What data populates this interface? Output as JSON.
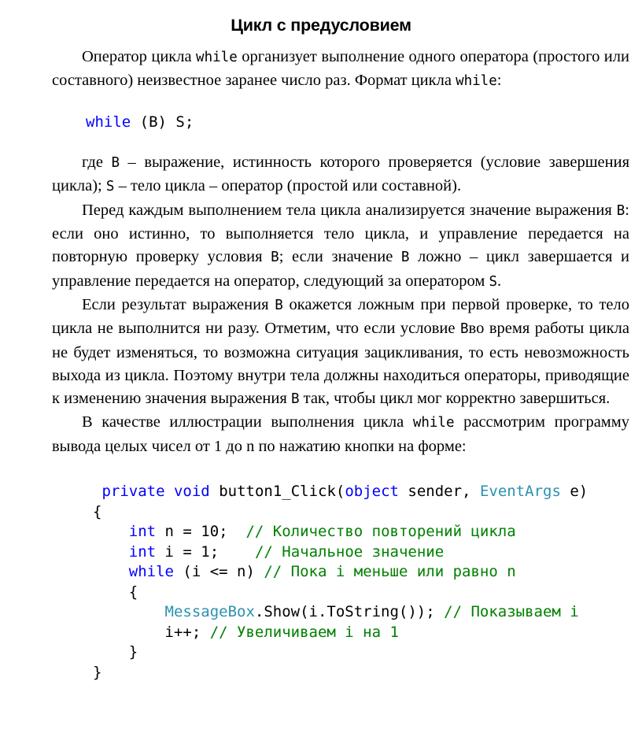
{
  "document": {
    "title": "Цикл с предусловием",
    "paragraphs": [
      {
        "id": "p1",
        "runs": [
          {
            "t": "Оператор цикла ",
            "s": "text"
          },
          {
            "t": "while",
            "s": "mono"
          },
          {
            "t": "  организует выполнение одного оператора (простого или составного) неизвестное заранее число раз. Формат цикла ",
            "s": "text"
          },
          {
            "t": "while",
            "s": "mono"
          },
          {
            "t": ":",
            "s": "text"
          }
        ]
      },
      {
        "id": "p2",
        "runs": [
          {
            "t": "где ",
            "s": "text"
          },
          {
            "t": "B",
            "s": "mono"
          },
          {
            "t": "  – выражение, истинность которого проверяется (условие завершения цикла); ",
            "s": "text"
          },
          {
            "t": "S",
            "s": "mono"
          },
          {
            "t": " – тело цикла – оператор (простой или составной).",
            "s": "text"
          }
        ]
      },
      {
        "id": "p3",
        "runs": [
          {
            "t": "Перед каждым выполнением тела цикла анализируется значение выражения ",
            "s": "text"
          },
          {
            "t": "B",
            "s": "mono"
          },
          {
            "t": ": если оно истинно, то выполняется тело цикла, и управление передается на повторную проверку условия ",
            "s": "text"
          },
          {
            "t": "B",
            "s": "mono"
          },
          {
            "t": "; если значение ",
            "s": "text"
          },
          {
            "t": "B",
            "s": "mono"
          },
          {
            "t": "  ложно – цикл завершается и управление передается на оператор, следующий за оператором ",
            "s": "text"
          },
          {
            "t": "S",
            "s": "mono"
          },
          {
            "t": ".",
            "s": "text"
          }
        ]
      },
      {
        "id": "p4",
        "runs": [
          {
            "t": "Если результат выражения ",
            "s": "text"
          },
          {
            "t": "B",
            "s": "mono"
          },
          {
            "t": "  окажется ложным при первой проверке, то тело цикла не выполнится ни разу. Отметим, что если условие  ",
            "s": "text"
          },
          {
            "t": "B",
            "s": "mono"
          },
          {
            "t": "во время работы цикла не будет изменяться, то возможна ситуация зацикливания, то есть невозможность выхода из цикла. Поэтому внутри тела должны находиться операторы, приводящие к изменению значения выражения ",
            "s": "text"
          },
          {
            "t": "B",
            "s": "mono"
          },
          {
            "t": " так, чтобы цикл мог корректно завершиться.",
            "s": "text"
          }
        ]
      },
      {
        "id": "p5",
        "runs": [
          {
            "t": "В качестве иллюстрации выполнения цикла ",
            "s": "text"
          },
          {
            "t": "while",
            "s": "mono"
          },
          {
            "t": "  рассмотрим программу вывода целых чисел от 1 до n по нажатию кнопки на форме:",
            "s": "text"
          }
        ]
      }
    ],
    "syntax_line": {
      "tokens": [
        {
          "t": "while",
          "c": "kw"
        },
        {
          "t": " (B) S;",
          "c": "pln"
        }
      ]
    },
    "code_listing": {
      "language": "csharp",
      "lines": [
        [
          {
            "t": " ",
            "c": "pln"
          },
          {
            "t": "private",
            "c": "kw"
          },
          {
            "t": " ",
            "c": "pln"
          },
          {
            "t": "void",
            "c": "kw"
          },
          {
            "t": " button1_Click(",
            "c": "pln"
          },
          {
            "t": "object",
            "c": "kw"
          },
          {
            "t": " sender, ",
            "c": "pln"
          },
          {
            "t": "EventArgs",
            "c": "type"
          },
          {
            "t": " e)",
            "c": "pln"
          }
        ],
        [
          {
            "t": "{",
            "c": "pln"
          }
        ],
        [
          {
            "t": "    ",
            "c": "pln"
          },
          {
            "t": "int",
            "c": "kw"
          },
          {
            "t": " n = 10;  ",
            "c": "pln"
          },
          {
            "t": "// Количество повторений цикла",
            "c": "cmt"
          }
        ],
        [
          {
            "t": "    ",
            "c": "pln"
          },
          {
            "t": "int",
            "c": "kw"
          },
          {
            "t": " i = 1;    ",
            "c": "pln"
          },
          {
            "t": "// Начальное значение",
            "c": "cmt"
          }
        ],
        [
          {
            "t": "    ",
            "c": "pln"
          },
          {
            "t": "while",
            "c": "kw"
          },
          {
            "t": " (i <= n) ",
            "c": "pln"
          },
          {
            "t": "// Пока i меньше или равно n",
            "c": "cmt"
          }
        ],
        [
          {
            "t": "    {",
            "c": "pln"
          }
        ],
        [
          {
            "t": "        ",
            "c": "pln"
          },
          {
            "t": "MessageBox",
            "c": "type"
          },
          {
            "t": ".Show(i.ToString()); ",
            "c": "pln"
          },
          {
            "t": "// Показываем i",
            "c": "cmt"
          }
        ],
        [
          {
            "t": "        i++; ",
            "c": "pln"
          },
          {
            "t": "// Увеличиваем i на 1",
            "c": "cmt"
          }
        ],
        [
          {
            "t": "    }",
            "c": "pln"
          }
        ],
        [
          {
            "t": "}",
            "c": "pln"
          }
        ]
      ]
    },
    "colors": {
      "keyword": "#0000ff",
      "type": "#2b91af",
      "comment": "#008000",
      "plain": "#000000",
      "background": "#ffffff"
    }
  }
}
